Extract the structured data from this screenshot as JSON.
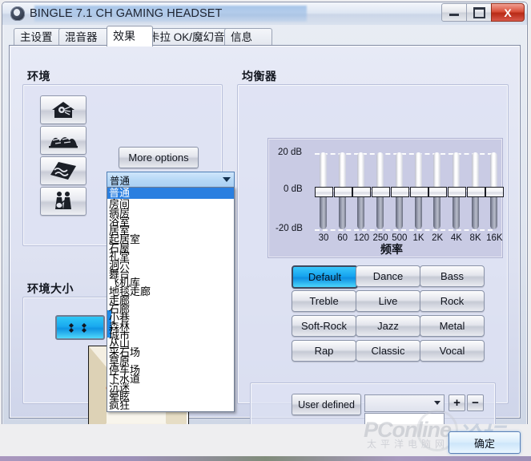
{
  "window": {
    "title": "BINGLE 7.1 CH GAMING HEADSET",
    "icon": "headset-icon",
    "minimize_label": "minimize",
    "maximize_label": "maximize",
    "close_label": "X"
  },
  "tabs": [
    {
      "label": "主设置",
      "active": false
    },
    {
      "label": "混音器",
      "active": false
    },
    {
      "label": "效果",
      "active": true
    },
    {
      "label": "卡拉 OK/魔幻音响",
      "active": false
    },
    {
      "label": "信息",
      "active": false
    }
  ],
  "environment": {
    "title": "环境",
    "icon_buttons": [
      {
        "name": "house-speaker-icon"
      },
      {
        "name": "opera-house-icon"
      },
      {
        "name": "wave-tile-icon"
      },
      {
        "name": "musicians-icon"
      }
    ],
    "more_options_label": "More options",
    "selected": "普通",
    "options": [
      "普通",
      "房间",
      "病房",
      "浴室",
      "居室",
      "起居室",
      "石屋",
      "礼堂",
      "洞穴",
      "舞台",
      "飞机库",
      "地毯走廊",
      "走廊",
      "石廊",
      "小巷",
      "森林",
      "城市",
      "丛山",
      "采石场",
      "草原",
      "停车场",
      "下水道",
      "沉迷",
      "晕眩",
      "疯狂"
    ]
  },
  "environment_size": {
    "title": "环境大小",
    "button_icon": "four-arrows-icon"
  },
  "equalizer": {
    "title": "均衡器",
    "db_labels": [
      "20 dB",
      "0  dB",
      "-20 dB"
    ],
    "frequency_title": "频率",
    "presets": [
      {
        "label": "Default",
        "active": true
      },
      {
        "label": "Dance",
        "active": false
      },
      {
        "label": "Bass",
        "active": false
      },
      {
        "label": "Treble",
        "active": false
      },
      {
        "label": "Live",
        "active": false
      },
      {
        "label": "Rock",
        "active": false
      },
      {
        "label": "Soft-Rock",
        "active": false
      },
      {
        "label": "Jazz",
        "active": false
      },
      {
        "label": "Metal",
        "active": false
      },
      {
        "label": "Rap",
        "active": false
      },
      {
        "label": "Classic",
        "active": false
      },
      {
        "label": "Vocal",
        "active": false
      }
    ],
    "user_defined_label": "User defined",
    "user_defined_value": "",
    "user_defined_name_value": "",
    "add_label": "+",
    "remove_label": "−"
  },
  "chart_data": {
    "type": "bar",
    "title": "均衡器",
    "xlabel": "频率",
    "ylabel": "dB",
    "categories": [
      "30",
      "60",
      "120",
      "250",
      "500",
      "1K",
      "2K",
      "4K",
      "8K",
      "16K"
    ],
    "values": [
      0,
      0,
      0,
      0,
      0,
      0,
      0,
      0,
      0,
      0
    ],
    "ylim": [
      -20,
      20
    ],
    "yticks": [
      -20,
      0,
      20
    ],
    "ytick_labels": [
      "-20 dB",
      "0  dB",
      "20 dB"
    ],
    "grid": true,
    "legend": "none"
  },
  "footer": {
    "ok_label": "确定",
    "watermark_primary": "PConline",
    "watermark_secondary": "太平洋电脑网",
    "watermark_overlay": "论坛"
  }
}
